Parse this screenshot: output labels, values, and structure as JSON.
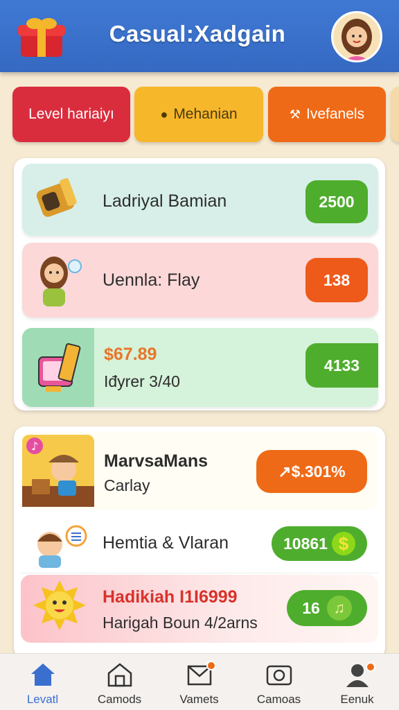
{
  "header": {
    "title": "Casual:Xadgain",
    "logo_icon": "gift-box-icon",
    "avatar_icon": "user-avatar-icon"
  },
  "tabs": [
    {
      "label": "Level hariaiyı",
      "color": "#d92d3e"
    },
    {
      "label": "Mehanian",
      "icon": "person-icon",
      "color": "#f7b72a"
    },
    {
      "label": "Ivefanels",
      "icon": "hammer-icon",
      "color": "#ef6a17"
    }
  ],
  "panel1": {
    "rows": [
      {
        "icon": "bell-crate-icon",
        "title": "Ladriyal Bamian",
        "value": "2500"
      },
      {
        "icon": "girl-waving-icon",
        "title": "Uennla: Flay",
        "value": "138"
      },
      {
        "icon": "gift-bag-icon",
        "price": "$67.89",
        "subtitle": "Iđyrer 3/40",
        "value": "4133"
      }
    ]
  },
  "panel2": {
    "rows": [
      {
        "icon": "musician-icon",
        "title": "MarvsaMans",
        "subtitle": "Carlay",
        "value": "↗$.301%"
      },
      {
        "icon": "boy-chat-icon",
        "title": "Hemtia & Vlaran",
        "value": "10861"
      },
      {
        "icon": "sun-mascot-icon",
        "title": "Hadikiah I1I6999",
        "subtitle": "Harigah Boun 4/2arns",
        "value": "16"
      }
    ]
  },
  "nav": [
    {
      "label": "Levatl",
      "icon": "home-icon",
      "active": true
    },
    {
      "label": "Camods",
      "icon": "house-outline-icon"
    },
    {
      "label": "Vamets",
      "icon": "mail-icon",
      "badge": true
    },
    {
      "label": "Camoas",
      "icon": "camera-icon"
    },
    {
      "label": "Eenuk",
      "icon": "profile-icon",
      "badge": true
    }
  ],
  "colors": {
    "header": "#3f79d4",
    "green_pill": "#4fad2e",
    "orange_pill": "#ee5a1a",
    "background": "#f7ead3"
  }
}
